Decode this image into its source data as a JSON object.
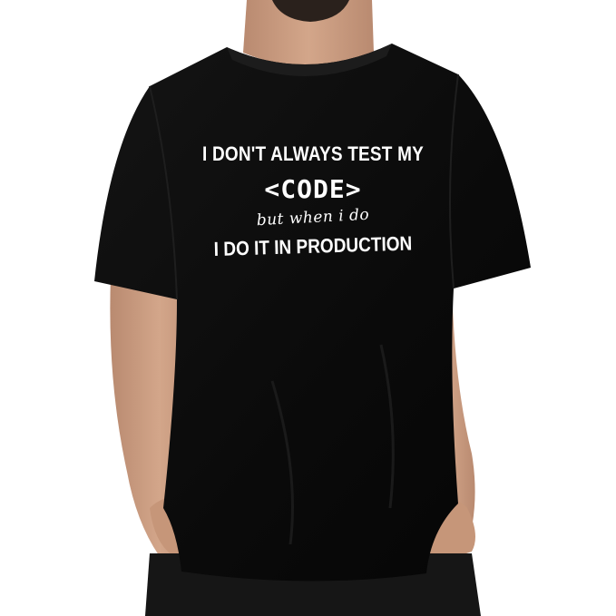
{
  "shirt": {
    "print_lines": [
      "I DON'T ALWAYS TEST MY",
      "<CODE>",
      "but when i do",
      "I DO IT IN PRODUCTION"
    ]
  },
  "colors": {
    "background": "#ffffff",
    "shirt": "#0b0b0b",
    "skin": "#c99a7e",
    "print": "#ffffff"
  }
}
